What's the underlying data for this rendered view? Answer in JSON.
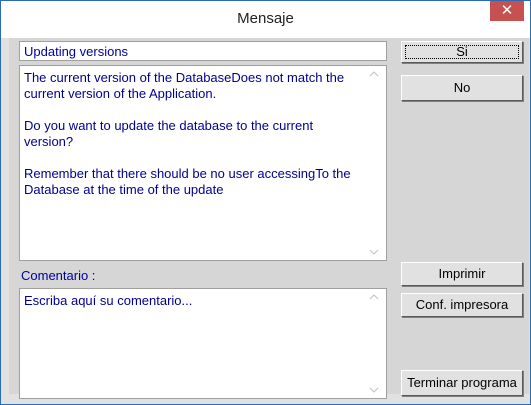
{
  "window": {
    "title": "Mensaje",
    "close_glyph": "✕"
  },
  "message": {
    "subject": "Updating versions",
    "paragraphs": [
      "The current version of the DatabaseDoes not match the current version of the Application.",
      " Do you want to update the database to the current version?",
      " Remember that there should be no user accessingTo the Database at the time of the update"
    ]
  },
  "comment": {
    "label": "Comentario :",
    "text": "Escriba aquí su comentario..."
  },
  "buttons": {
    "si": "Si",
    "no": "No",
    "imprimir": "Imprimir",
    "conf_impresora": "Conf. impresora",
    "terminar": "Terminar programa"
  },
  "colors": {
    "text_blue": "#0000a0",
    "close_red": "#c75050",
    "dialog_gray": "#d6d6d6"
  },
  "icons": {
    "scroll_up": "^",
    "scroll_down": "v"
  }
}
